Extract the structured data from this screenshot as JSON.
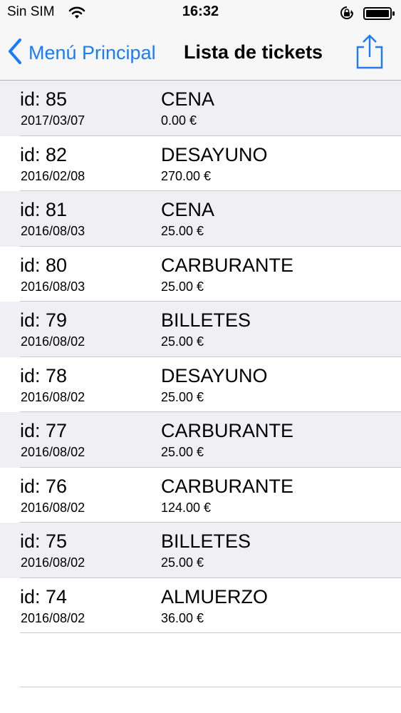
{
  "status_bar": {
    "carrier": "Sin SIM",
    "time": "16:32"
  },
  "nav": {
    "back_label": "Menú Principal",
    "title": "Lista de tickets",
    "accent_color": "#1a7cf6"
  },
  "tickets": [
    {
      "id": "id: 85",
      "date": "2017/03/07",
      "category": "CENA",
      "amount": "0.00 €"
    },
    {
      "id": "id: 82",
      "date": "2016/02/08",
      "category": "DESAYUNO",
      "amount": "270.00 €"
    },
    {
      "id": "id: 81",
      "date": "2016/08/03",
      "category": "CENA",
      "amount": "25.00 €"
    },
    {
      "id": "id: 80",
      "date": "2016/08/03",
      "category": "CARBURANTE",
      "amount": "25.00 €"
    },
    {
      "id": "id: 79",
      "date": "2016/08/02",
      "category": "BILLETES",
      "amount": "25.00 €"
    },
    {
      "id": "id: 78",
      "date": "2016/08/02",
      "category": "DESAYUNO",
      "amount": "25.00 €"
    },
    {
      "id": "id: 77",
      "date": "2016/08/02",
      "category": "CARBURANTE",
      "amount": "25.00 €"
    },
    {
      "id": "id: 76",
      "date": "2016/08/02",
      "category": "CARBURANTE",
      "amount": "124.00 €"
    },
    {
      "id": "id: 75",
      "date": "2016/08/02",
      "category": "BILLETES",
      "amount": "25.00 €"
    },
    {
      "id": "id: 74",
      "date": "2016/08/02",
      "category": "ALMUERZO",
      "amount": "36.00 €"
    }
  ]
}
